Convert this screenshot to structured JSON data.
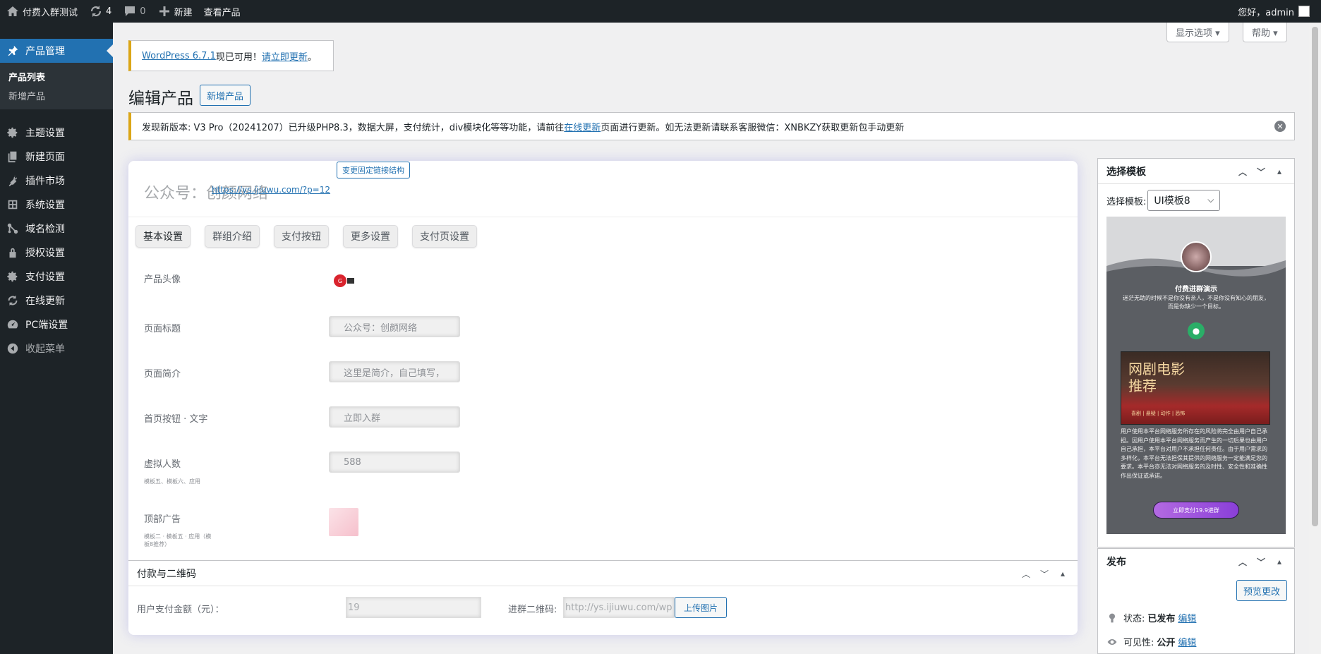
{
  "adminbar": {
    "site_name": "付费入群测试",
    "updates_count": "4",
    "comments_count": "0",
    "new_label": "新建",
    "view_label": "查看产品",
    "greeting": "您好，admin"
  },
  "sidebar": {
    "current": "产品管理",
    "submenu": [
      "产品列表",
      "新增产品"
    ],
    "items": [
      "主题设置",
      "新建页面",
      "插件市场",
      "系统设置",
      "域名检测",
      "授权设置",
      "支付设置",
      "在线更新",
      "PC端设置",
      "收起菜单"
    ]
  },
  "screen": {
    "options": "显示选项 ▾",
    "help": "帮助 ▾"
  },
  "notice_update": {
    "link_version": "WordPress 6.7.1",
    "text": " 现已可用！",
    "link_update": "请立即更新",
    "end": "。"
  },
  "page": {
    "title": "编辑产品",
    "add_new": "新增产品"
  },
  "notice_version": {
    "text_before": "发现新版本: V3 Pro（20241207）已升级PHP8.3，数据大屏，支付统计，div模块化等等功能，请前往 ",
    "link": "在线更新",
    "text_after": " 页面进行更新。如无法更新请联系客服微信：XNBKZY获取更新包手动更新"
  },
  "editor": {
    "title_text": "公众号：创颜网络",
    "permalink": "https://ys.ijiuwu.com/?p=12",
    "change_permalink": "变更固定链接结构",
    "tabs": [
      "基本设置",
      "群组介绍",
      "支付按钮",
      "更多设置",
      "支付页设置"
    ],
    "fields": {
      "avatar_label": "产品头像",
      "title_label": "页面标题",
      "title_value": "公众号：创颜网络",
      "intro_label": "页面简介",
      "intro_value": "这里是简介，自己填写，",
      "btn_label": "首页按钮 · 文字",
      "btn_value": "立即入群",
      "virtual_label": "虚拟人数",
      "virtual_sub": "模板五、模板六、应用",
      "virtual_value": "588",
      "ad_label": "顶部广告",
      "ad_sub": "模板二 · 模板五 · 应用（模板8推荐）"
    }
  },
  "paybox": {
    "title": "付款与二维码",
    "amount_label": "用户支付金额（元）：",
    "amount_value": "19",
    "qr_label": "进群二维码:",
    "qr_value": "http://ys.ijiuwu.com/wp",
    "upload": "上传图片"
  },
  "template_box": {
    "title": "选择模板",
    "label": "选择模板:",
    "selected": "UI模板8",
    "preview": {
      "name": "付费进群演示",
      "desc": "迷茫无助的时候不是你没有亲人，不是你没有知心的朋友，而是你缺少一个目标。",
      "banner_title_1": "网剧电影",
      "banner_title_2": "推荐",
      "banner_sub": "喜剧 | 悬疑 | 动作 | 恐怖",
      "terms": "用户使用本平台网络服务所存在的风险将完全由用户自己承担。因用户使用本平台网络服务而产生的一切后果也由用户自己承担，本平台对用户不承担任何责任。由于用户需求的多样化，本平台无法担保其提供的网络服务一定能满足您的要求。本平台亦无法对网络服务的及时性、安全性和准确性作出保证或承诺。",
      "button": "立即支付19.9进群"
    }
  },
  "publish_box": {
    "title": "发布",
    "preview_btn": "预览更改",
    "status_label": "状态:",
    "status_value": "已发布",
    "visibility_label": "可见性:",
    "visibility_value": "公开",
    "edit": "编辑"
  }
}
